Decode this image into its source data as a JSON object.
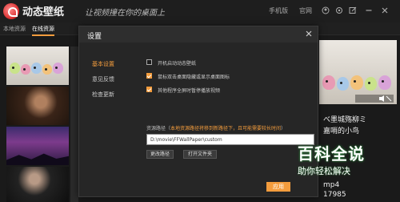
{
  "app": {
    "title": "动态壁纸",
    "slogan": "让视频撞在你的桌面上"
  },
  "topbar": {
    "mobile_label": "手机版",
    "official_label": "官网",
    "icons": [
      "user-icon",
      "settings-icon",
      "skin-icon",
      "minimize-icon",
      "close-icon"
    ]
  },
  "tabs": [
    {
      "label": "本地资源"
    },
    {
      "label": "在线资源"
    }
  ],
  "dialog": {
    "title": "设置",
    "nav": [
      {
        "label": "基本设置"
      },
      {
        "label": "意见反馈"
      },
      {
        "label": "检查更新"
      }
    ],
    "options": [
      {
        "label": "开机启动动态壁纸",
        "checked": false
      },
      {
        "label": "鼠标双击桌面隐藏或显示桌面图标",
        "checked": true
      },
      {
        "label": "其他程序全屏时暂停播放视频",
        "checked": true
      }
    ],
    "path_label": "资源路径（",
    "path_hint": "本地资源路径将移到新路径下，且可能需要较长时间",
    "path_label_end": "）",
    "path_value": "D:\\movie\\FFWallPaper\\custom",
    "change_path_button": "更改路径",
    "open_folder_button": "打开文件夹",
    "apply_button": "应用"
  },
  "right_panel": {
    "title_line1": "べ墨城殇柳ミ",
    "title_line2": "嘉哨的小鸟",
    "format": "mp4",
    "count": "17985"
  },
  "watermark": {
    "title": "百科全说",
    "subtitle": "助你轻松解决"
  },
  "colors": {
    "accent": "#f39c3d",
    "background": "#1a1a1a",
    "dialog_bg": "#262626",
    "watermark_green": "#2a8c3b"
  }
}
